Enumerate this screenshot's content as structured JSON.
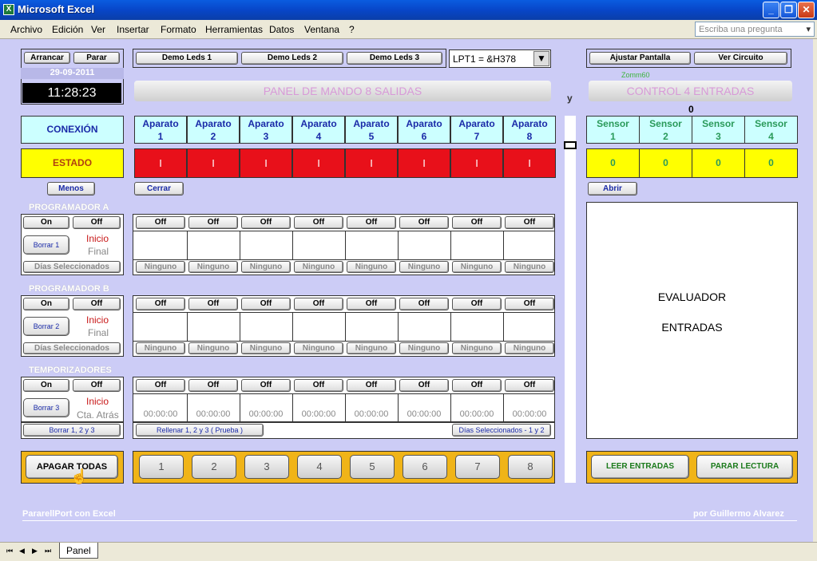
{
  "window": {
    "title": "Microsoft Excel",
    "icon": "X"
  },
  "menu": [
    "Archivo",
    "Edición",
    "Ver",
    "Insertar",
    "Formato",
    "Herramientas",
    "Datos",
    "Ventana",
    "?"
  ],
  "ask_placeholder": "Escriba una pregunta",
  "top": {
    "arrancar": "Arrancar",
    "parar": "Parar",
    "date": "29-09-2011",
    "time": "11:28:23",
    "demo1": "Demo Leds 1",
    "demo2": "Demo Leds 2",
    "demo3": "Demo Leds 3",
    "port": "LPT1  =  &H378",
    "ajustar": "Ajustar Pantalla",
    "ver": "Ver Circuito",
    "zoom": "Zomm60"
  },
  "panel_title": "PANEL DE MANDO    8  SALIDAS",
  "y_label": "y",
  "control_title": "CONTROL   4  ENTRADAS",
  "zero_label": "0",
  "conexion": "CONEXIÓN",
  "estado": "ESTADO",
  "aparatos": [
    {
      "name": "Aparato",
      "num": "1",
      "state": "I"
    },
    {
      "name": "Aparato",
      "num": "2",
      "state": "I"
    },
    {
      "name": "Aparato",
      "num": "3",
      "state": "I"
    },
    {
      "name": "Aparato",
      "num": "4",
      "state": "I"
    },
    {
      "name": "Aparato",
      "num": "5",
      "state": "I"
    },
    {
      "name": "Aparato",
      "num": "6",
      "state": "I"
    },
    {
      "name": "Aparato",
      "num": "7",
      "state": "I"
    },
    {
      "name": "Aparato",
      "num": "8",
      "state": "I"
    }
  ],
  "sensors": [
    {
      "name": "Sensor",
      "num": "1",
      "value": "0"
    },
    {
      "name": "Sensor",
      "num": "2",
      "value": "0"
    },
    {
      "name": "Sensor",
      "num": "3",
      "value": "0"
    },
    {
      "name": "Sensor",
      "num": "4",
      "value": "0"
    }
  ],
  "menos": "Menos",
  "cerrar": "Cerrar",
  "abrir": "Abrir",
  "prog_a": {
    "title": "PROGRAMADOR  A",
    "on": "On",
    "off": "Off",
    "borrar": "Borrar 1",
    "inicio": "Inicio",
    "final": "Final",
    "dias": "Días Seleccionados"
  },
  "prog_b": {
    "title": "PROGRAMADOR  B",
    "on": "On",
    "off": "Off",
    "borrar": "Borrar 2",
    "inicio": "Inicio",
    "final": "Final",
    "dias": "Días Seleccionados"
  },
  "temp": {
    "title": "TEMPORIZADORES",
    "on": "On",
    "off": "Off",
    "borrar": "Borrar 3",
    "inicio": "Inicio",
    "cta": "Cta. Atrás",
    "borrar_all": "Borrar  1, 2 y 3",
    "rellenar": "Rellenar  1, 2 y 3   ( Prueba )",
    "dias": "Días Seleccionados  - 1 y 2"
  },
  "off_label": "Off",
  "ninguno_label": "Ninguno",
  "time_zero": "00:00:00",
  "evaluador": [
    "EVALUADOR",
    "ENTRADAS"
  ],
  "apagar": "APAGAR TODAS",
  "numbers": [
    "1",
    "2",
    "3",
    "4",
    "5",
    "6",
    "7",
    "8"
  ],
  "leer": "LEER ENTRADAS",
  "parar_lectura": "PARAR  LECTURA",
  "footer_left": "PararellPort con Excel",
  "footer_right": "por Guillermo Alvarez",
  "sheet_tab": "Panel",
  "colors": {
    "red": "#e8101a",
    "yellow": "#ffff00",
    "cyan": "#ccffff",
    "orange": "#f0b418",
    "sheet": "#ccccf6"
  }
}
